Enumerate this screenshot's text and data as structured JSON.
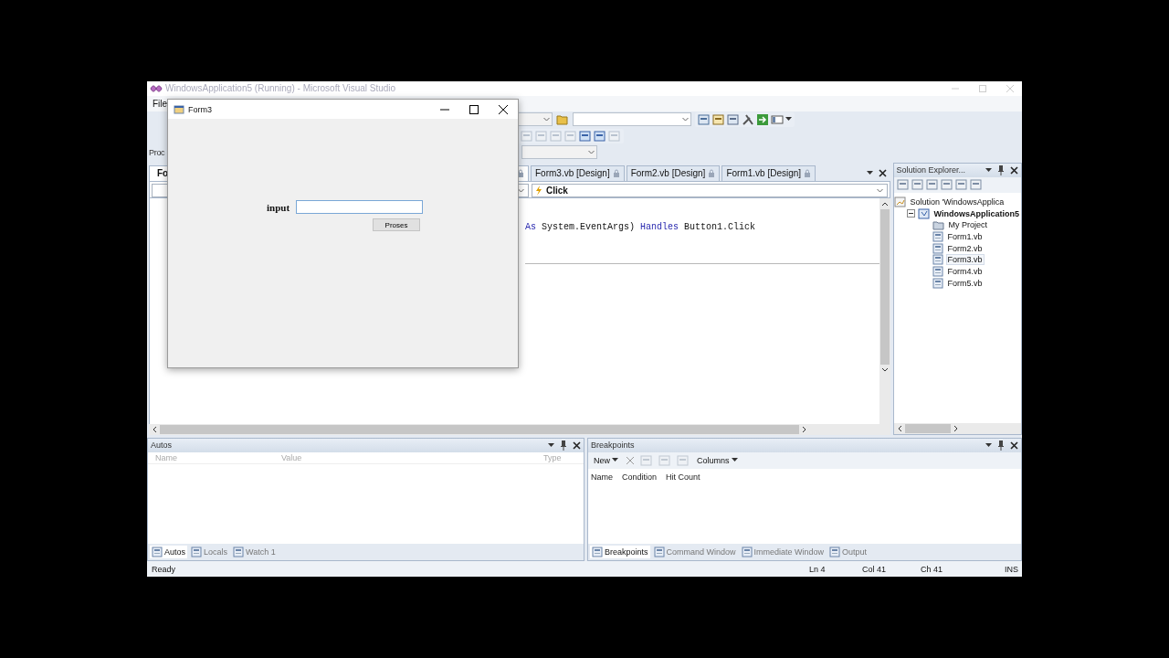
{
  "window": {
    "title": "WindowsApplication5 (Running) - Microsoft Visual Studio"
  },
  "menu": [
    {
      "label": "File"
    }
  ],
  "debug_location_bar": {
    "label": "Proc"
  },
  "document_tabs": [
    {
      "label": "Fo",
      "selected": true
    },
    {
      "label": "Form3.vb [Design]",
      "selected": false
    },
    {
      "label": "Form2.vb [Design]",
      "selected": false
    },
    {
      "label": "Form1.vb [Design]",
      "selected": false
    }
  ],
  "editor": {
    "event_dropdown": "Click",
    "lines": [
      {
        "tokens": [
          {
            "text": "As",
            "kind": "keyword"
          },
          {
            "text": " System.EventArgs) ",
            "kind": "plain"
          },
          {
            "text": "Handles",
            "kind": "keyword"
          },
          {
            "text": " Button1.Click",
            "kind": "plain"
          }
        ]
      }
    ]
  },
  "solution_explorer": {
    "title": "Solution Explorer...",
    "tree": [
      {
        "label": "Solution 'WindowsApplica",
        "kind": "solution",
        "selected": false,
        "children": [
          {
            "label": "WindowsApplication5",
            "kind": "project",
            "selected": false,
            "children": [
              {
                "label": "My Project",
                "kind": "properties",
                "selected": false
              },
              {
                "label": "Form1.vb",
                "kind": "form",
                "selected": false
              },
              {
                "label": "Form2.vb",
                "kind": "form",
                "selected": false
              },
              {
                "label": "Form3.vb",
                "kind": "form",
                "selected": true
              },
              {
                "label": "Form4.vb",
                "kind": "form",
                "selected": false
              },
              {
                "label": "Form5.vb",
                "kind": "form",
                "selected": false
              }
            ]
          }
        ]
      }
    ]
  },
  "autos": {
    "title": "Autos",
    "columns": [
      "Name",
      "Value",
      "Type"
    ]
  },
  "autos_tabs": [
    {
      "label": "Autos",
      "selected": true
    },
    {
      "label": "Locals",
      "selected": false
    },
    {
      "label": "Watch 1",
      "selected": false
    }
  ],
  "breakpoints": {
    "title": "Breakpoints",
    "new_button": "New",
    "columns_button": "Columns",
    "columns": [
      "Name",
      "Condition",
      "Hit Count"
    ]
  },
  "breakpoints_tabs": [
    {
      "label": "Breakpoints",
      "selected": true
    },
    {
      "label": "Command Window",
      "selected": false
    },
    {
      "label": "Immediate Window",
      "selected": false
    },
    {
      "label": "Output",
      "selected": false
    }
  ],
  "status_bar": {
    "message": "Ready",
    "line": "Ln 4",
    "column": "Col 41",
    "char": "Ch 41",
    "mode": "INS"
  },
  "form_window": {
    "title": "Form3",
    "label": "input",
    "button": "Proses"
  }
}
